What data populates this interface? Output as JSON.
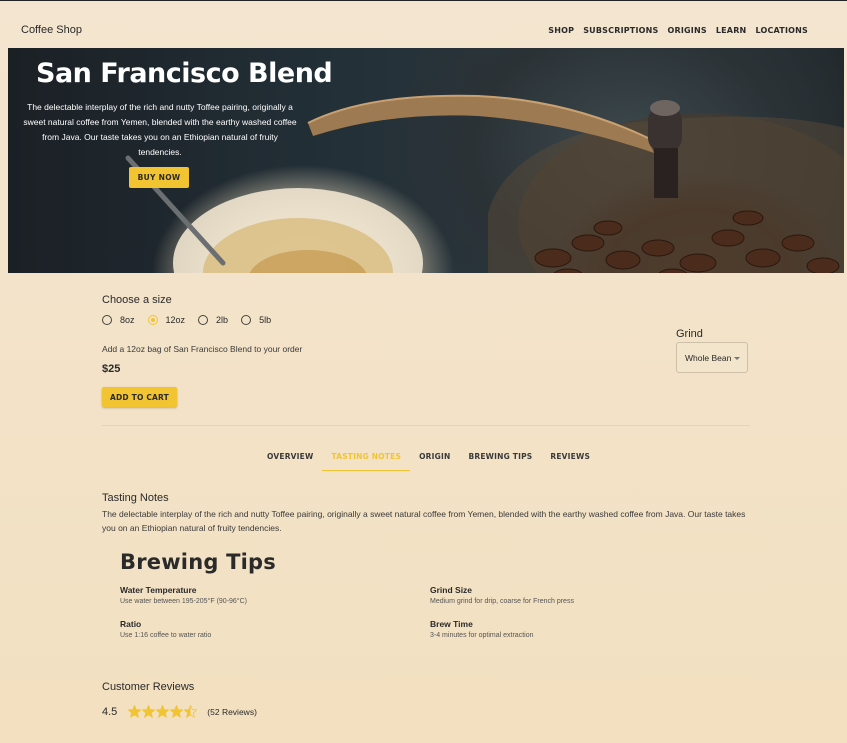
{
  "header": {
    "brand": "Coffee Shop",
    "nav": [
      "SHOP",
      "SUBSCRIPTIONS",
      "ORIGINS",
      "LEARN",
      "LOCATIONS"
    ]
  },
  "hero": {
    "title": "San Francisco Blend",
    "description": "The delectable interplay of the rich and nutty Toffee pairing, originally a sweet natural coffee from Yemen, blended with the earthy washed coffee from Java. Our taste takes you on an Ethiopian natural of fruity tendencies.",
    "buy_label": "BUY NOW"
  },
  "product": {
    "size_title": "Choose a size",
    "sizes": [
      "8oz",
      "12oz",
      "2lb",
      "5lb"
    ],
    "selected_size": "12oz",
    "add_text": "Add a 12oz bag of San Francisco Blend to your order",
    "price": "$25",
    "cart_label": "ADD TO CART",
    "grind_label": "Grind",
    "grind_value": "Whole Bean"
  },
  "tabs": {
    "items": [
      "OVERVIEW",
      "TASTING NOTES",
      "ORIGIN",
      "BREWING TIPS",
      "REVIEWS"
    ],
    "active": "TASTING NOTES"
  },
  "tasting": {
    "title": "Tasting Notes",
    "text": "The delectable interplay of the rich and nutty Toffee pairing, originally a sweet natural coffee from Yemen, blended with the earthy washed coffee from Java. Our taste takes you on an Ethiopian natural of fruity tendencies."
  },
  "brewing": {
    "title": "Brewing Tips",
    "tips": [
      {
        "heading": "Water Temperature",
        "detail": "Use water between 195-205°F (90-96°C)"
      },
      {
        "heading": "Grind Size",
        "detail": "Medium grind for drip, coarse for French press"
      },
      {
        "heading": "Ratio",
        "detail": "Use 1:16 coffee to water ratio"
      },
      {
        "heading": "Brew Time",
        "detail": "3-4 minutes for optimal extraction"
      }
    ]
  },
  "reviews": {
    "title": "Customer Reviews",
    "rating": "4.5",
    "rating_value": 4.5,
    "count": "(52 Reviews)"
  },
  "colors": {
    "accent": "#f2c431",
    "background": "#f4e5d0"
  }
}
